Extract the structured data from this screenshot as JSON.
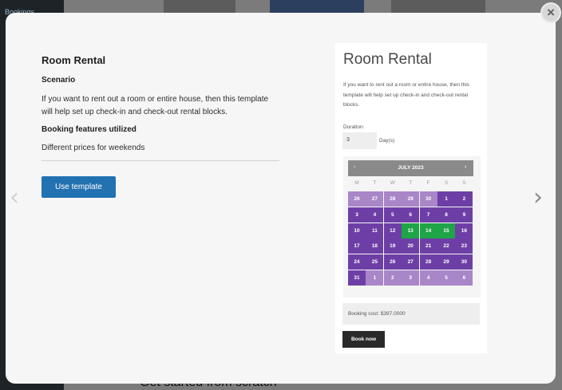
{
  "background": {
    "sidebar_title": "Bookings",
    "bottom_text": "Get started from scratch"
  },
  "modal": {
    "close_icon": "×",
    "prev_icon": "‹",
    "next_icon": "›"
  },
  "template": {
    "title": "Room Rental",
    "scenario_label": "Scenario",
    "scenario_text": "If you want to rent out a room or entire house, then this template will help set up check-in and check-out rental blocks.",
    "features_label": "Booking features utilized",
    "features_text": "Different prices for weekends",
    "use_button": "Use template"
  },
  "preview": {
    "title": "Room Rental",
    "description": "If you want to rent out a room or entire house, then this template will help set up check-in and check-out rental blocks.",
    "duration_label": "Duration:",
    "duration_value": "3",
    "duration_unit": "Day(s)",
    "calendar": {
      "month": "JULY 2023",
      "prev": "‹",
      "next": "›",
      "weekdays": [
        "M",
        "T",
        "W",
        "T",
        "F",
        "S",
        "S"
      ],
      "weeks": [
        [
          {
            "d": "26",
            "t": "prev"
          },
          {
            "d": "27",
            "t": "prev"
          },
          {
            "d": "28",
            "t": "prev"
          },
          {
            "d": "29",
            "t": "prev"
          },
          {
            "d": "30",
            "t": "prev"
          },
          {
            "d": "1",
            "t": "cur"
          },
          {
            "d": "2",
            "t": "cur"
          }
        ],
        [
          {
            "d": "3",
            "t": "cur"
          },
          {
            "d": "4",
            "t": "cur"
          },
          {
            "d": "5",
            "t": "cur"
          },
          {
            "d": "6",
            "t": "cur"
          },
          {
            "d": "7",
            "t": "cur"
          },
          {
            "d": "8",
            "t": "cur"
          },
          {
            "d": "9",
            "t": "cur"
          }
        ],
        [
          {
            "d": "10",
            "t": "cur"
          },
          {
            "d": "11",
            "t": "cur"
          },
          {
            "d": "12",
            "t": "cur"
          },
          {
            "d": "13",
            "t": "sel"
          },
          {
            "d": "14",
            "t": "sel"
          },
          {
            "d": "15",
            "t": "sel"
          },
          {
            "d": "16",
            "t": "cur"
          }
        ],
        [
          {
            "d": "17",
            "t": "cur"
          },
          {
            "d": "18",
            "t": "cur"
          },
          {
            "d": "19",
            "t": "cur"
          },
          {
            "d": "20",
            "t": "cur"
          },
          {
            "d": "21",
            "t": "cur"
          },
          {
            "d": "22",
            "t": "cur"
          },
          {
            "d": "23",
            "t": "cur"
          }
        ],
        [
          {
            "d": "24",
            "t": "cur"
          },
          {
            "d": "25",
            "t": "cur"
          },
          {
            "d": "26",
            "t": "cur"
          },
          {
            "d": "27",
            "t": "cur"
          },
          {
            "d": "28",
            "t": "cur"
          },
          {
            "d": "29",
            "t": "cur"
          },
          {
            "d": "30",
            "t": "cur"
          }
        ],
        [
          {
            "d": "31",
            "t": "cur"
          },
          {
            "d": "1",
            "t": "next"
          },
          {
            "d": "2",
            "t": "next"
          },
          {
            "d": "3",
            "t": "next"
          },
          {
            "d": "4",
            "t": "next"
          },
          {
            "d": "5",
            "t": "next"
          },
          {
            "d": "6",
            "t": "next"
          }
        ]
      ]
    },
    "cost_text": "Booking cost: $397.0000",
    "book_button": "Book now"
  },
  "colors": {
    "accent": "#2271b1",
    "calendar_current": "#6d3fa6",
    "calendar_other": "#a886c7",
    "calendar_selected": "#1fa447"
  }
}
